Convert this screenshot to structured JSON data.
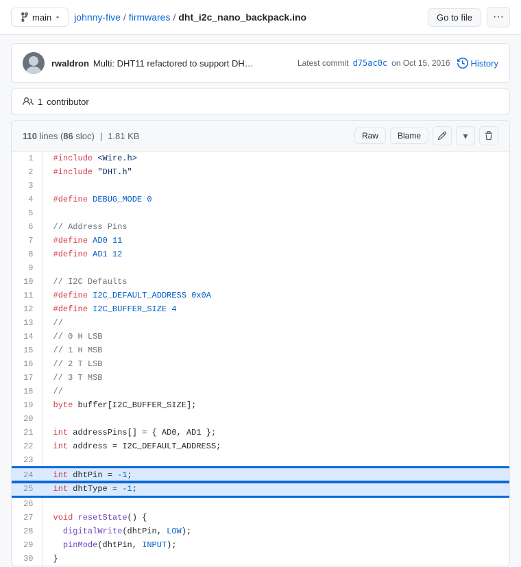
{
  "topbar": {
    "branch": "main",
    "repo_owner": "johnny-five",
    "repo_slash": "/",
    "repo_firmwares": "firmwares",
    "repo_slash2": "/",
    "filename": "dht_i2c_nano_backpack.ino",
    "goto_file": "Go to file",
    "more_options": "···"
  },
  "commit": {
    "author": "rwaldron",
    "message": "Multi: DHT11 refactored to support DH…",
    "latest_commit_label": "Latest commit",
    "hash": "d75ac0c",
    "date": "on Oct 15, 2016",
    "history_label": "History"
  },
  "contributor": {
    "icon": "👤",
    "count": "1",
    "label": "contributor"
  },
  "file": {
    "lines": "110",
    "sloc": "86",
    "size": "1.81 KB",
    "raw_label": "Raw",
    "blame_label": "Blame"
  },
  "code_lines": [
    {
      "num": 1,
      "code": "#include <Wire.h>"
    },
    {
      "num": 2,
      "code": "#include \"DHT.h\""
    },
    {
      "num": 3,
      "code": ""
    },
    {
      "num": 4,
      "code": "#define DEBUG_MODE 0"
    },
    {
      "num": 5,
      "code": ""
    },
    {
      "num": 6,
      "code": "// Address Pins"
    },
    {
      "num": 7,
      "code": "#define AD0 11"
    },
    {
      "num": 8,
      "code": "#define AD1 12"
    },
    {
      "num": 9,
      "code": ""
    },
    {
      "num": 10,
      "code": "// I2C Defaults"
    },
    {
      "num": 11,
      "code": "#define I2C_DEFAULT_ADDRESS 0x0A"
    },
    {
      "num": 12,
      "code": "#define I2C_BUFFER_SIZE 4"
    },
    {
      "num": 13,
      "code": "//"
    },
    {
      "num": 14,
      "code": "// 0 H LSB"
    },
    {
      "num": 15,
      "code": "// 1 H MSB"
    },
    {
      "num": 16,
      "code": "// 2 T LSB"
    },
    {
      "num": 17,
      "code": "// 3 T MSB"
    },
    {
      "num": 18,
      "code": "//"
    },
    {
      "num": 19,
      "code": "byte buffer[I2C_BUFFER_SIZE];"
    },
    {
      "num": 20,
      "code": ""
    },
    {
      "num": 21,
      "code": "int addressPins[] = { AD0, AD1 };"
    },
    {
      "num": 22,
      "code": "int address = I2C_DEFAULT_ADDRESS;"
    },
    {
      "num": 23,
      "code": ""
    },
    {
      "num": 24,
      "code": "int dhtPin = -1;",
      "highlight": true,
      "highlight_start": true
    },
    {
      "num": 25,
      "code": "int dhtType = -1;",
      "highlight": true,
      "highlight_end": true
    },
    {
      "num": 26,
      "code": ""
    },
    {
      "num": 27,
      "code": "void resetState() {"
    },
    {
      "num": 28,
      "code": "  digitalWrite(dhtPin, LOW);"
    },
    {
      "num": 29,
      "code": "  pinMode(dhtPin, INPUT);"
    },
    {
      "num": 30,
      "code": "}"
    }
  ]
}
